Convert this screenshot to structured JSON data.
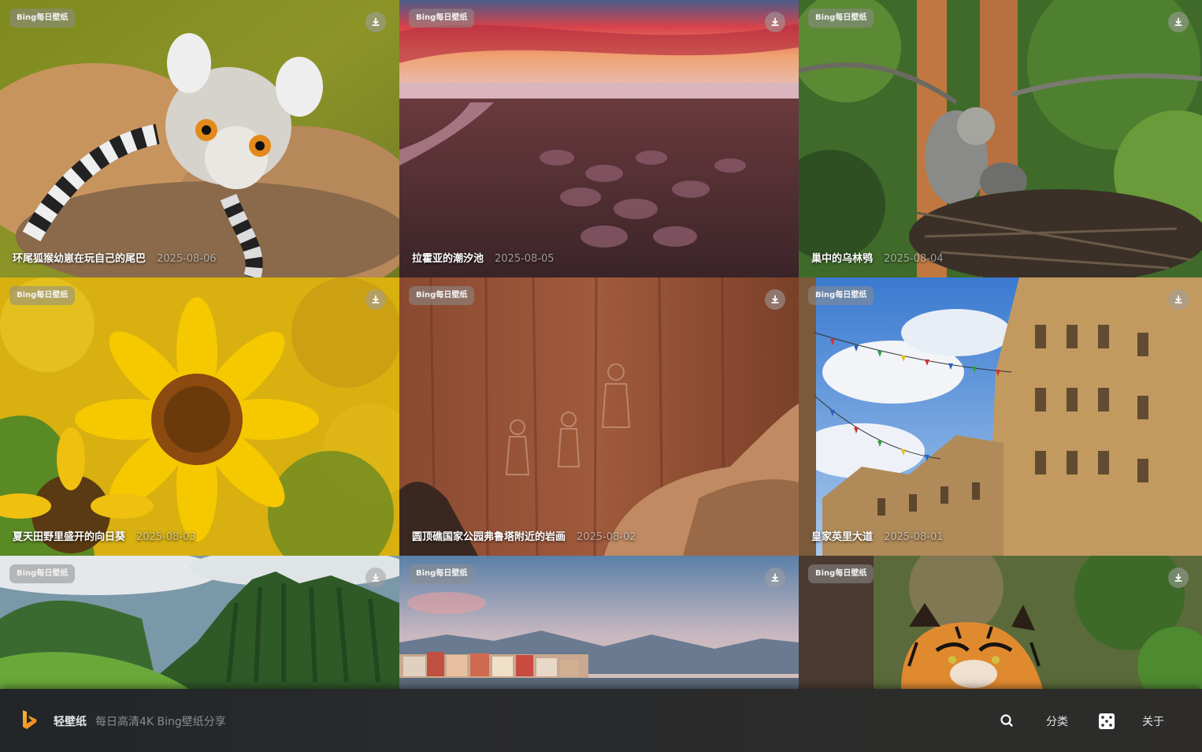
{
  "cards": [
    {
      "tag": "Bing每日壁纸",
      "title": "环尾狐猴幼崽在玩自己的尾巴",
      "date": "2025-08-06"
    },
    {
      "tag": "Bing每日壁纸",
      "title": "拉霍亚的潮汐池",
      "date": "2025-08-05"
    },
    {
      "tag": "Bing每日壁纸",
      "title": "巢中的乌林鸮",
      "date": "2025-08-04"
    },
    {
      "tag": "Bing每日壁纸",
      "title": "夏天田野里盛开的向日葵",
      "date": "2025-08-03"
    },
    {
      "tag": "Bing每日壁纸",
      "title": "圆顶礁国家公园弗鲁塔附近的岩画",
      "date": "2025-08-02"
    },
    {
      "tag": "Bing每日壁纸",
      "title": "皇家英里大道",
      "date": "2025-08-01"
    },
    {
      "tag": "Bing每日壁纸"
    },
    {
      "tag": "Bing每日壁纸"
    },
    {
      "tag": "Bing每日壁纸"
    }
  ],
  "footer": {
    "brand": "轻壁纸",
    "slogan": "每日高清4K Bing壁纸分享",
    "nav_category": "分类",
    "nav_about": "关于"
  },
  "icons": {
    "logo": "bing-logo-icon",
    "download": "download-icon",
    "search": "search-icon",
    "random": "dice-icon"
  },
  "colors": {
    "logo_orange": "#f0a030",
    "bar_bg": "#26292b"
  }
}
